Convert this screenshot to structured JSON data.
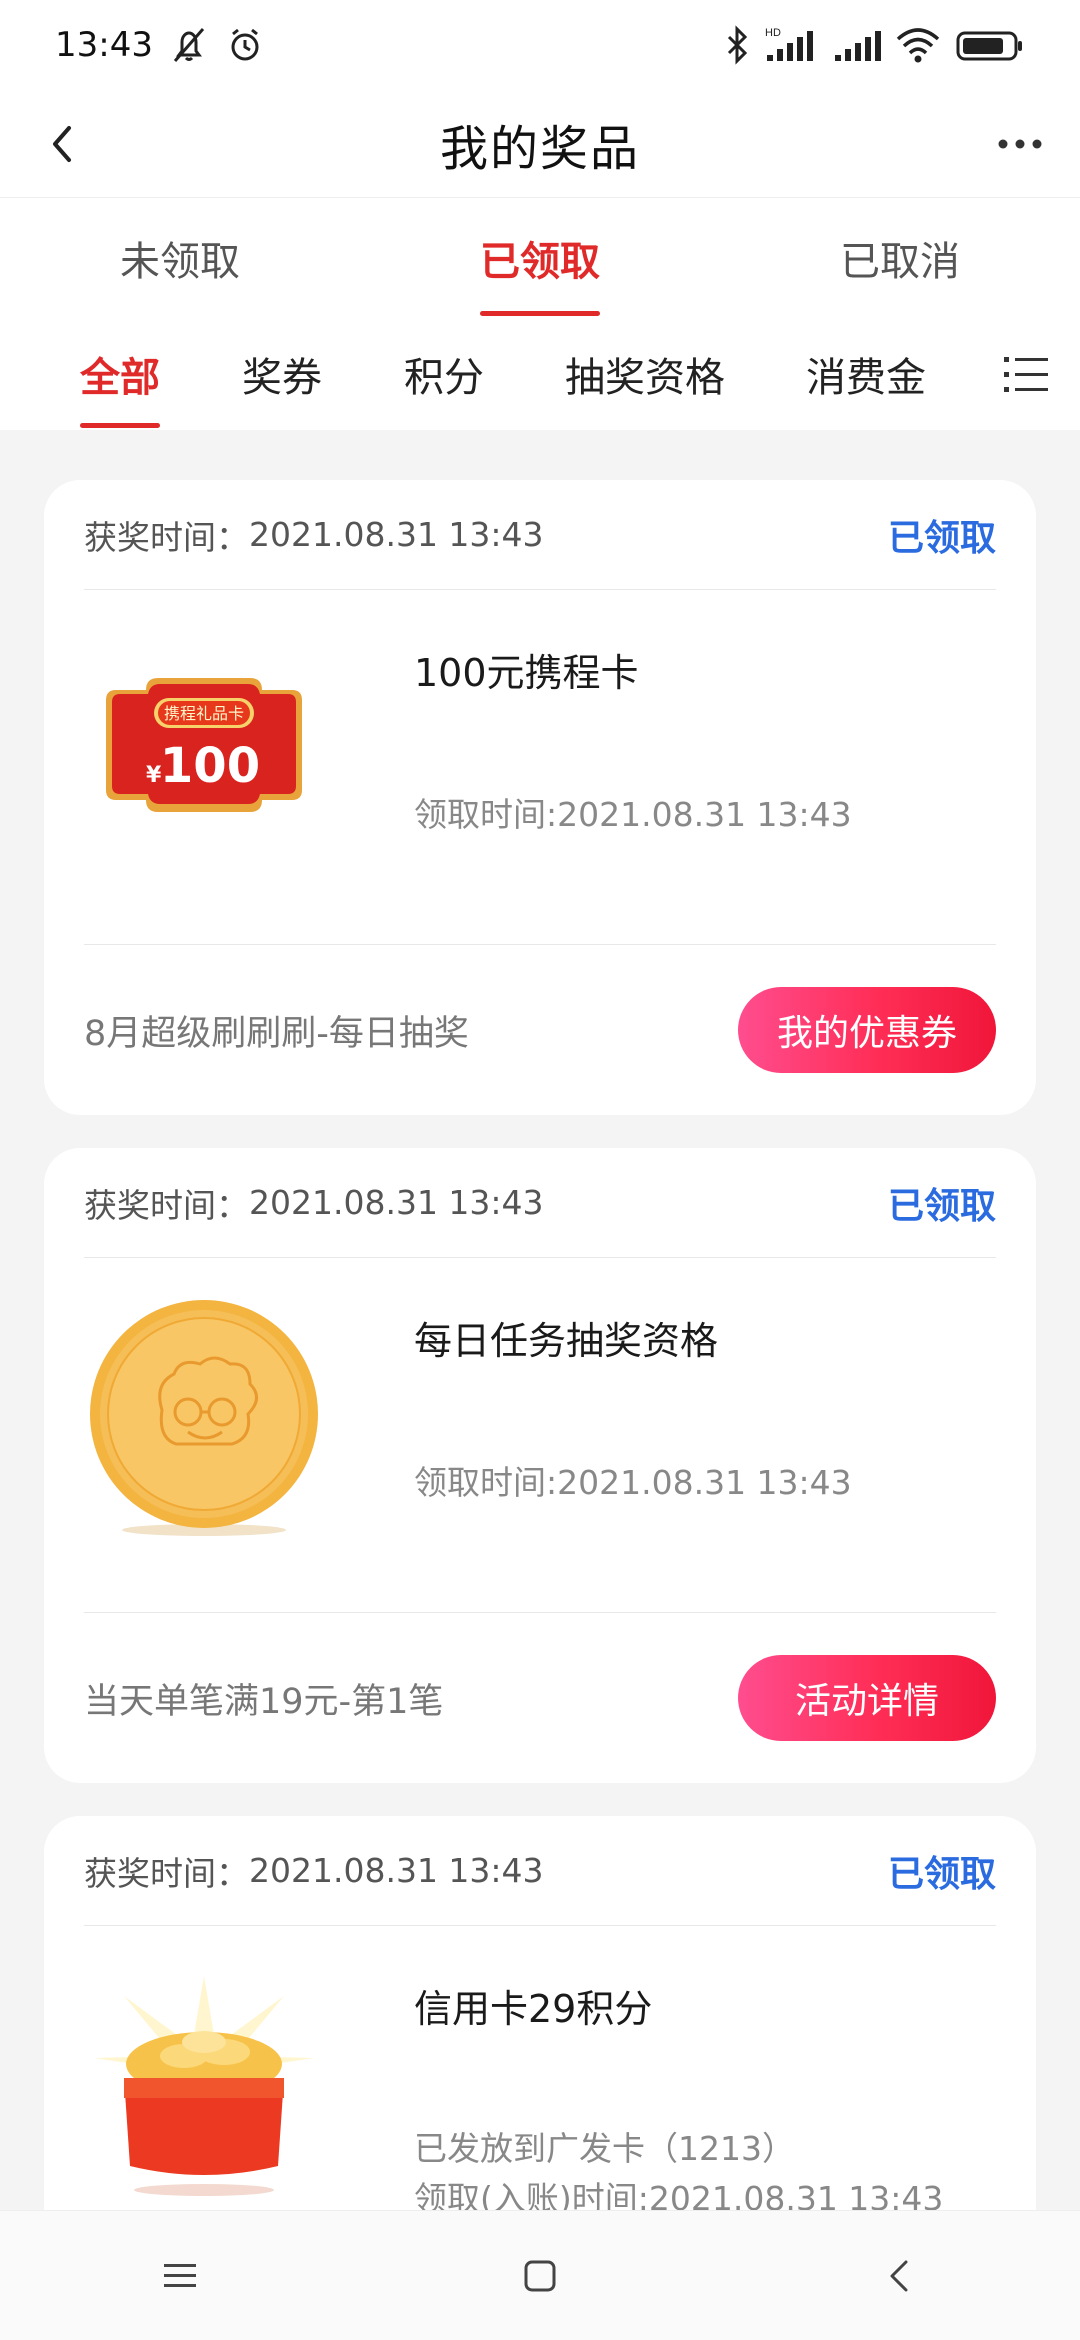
{
  "status_bar": {
    "time": "13:43",
    "hd_label": "HD"
  },
  "header": {
    "title": "我的奖品"
  },
  "status_tabs": [
    {
      "label": "未领取",
      "active": false
    },
    {
      "label": "已领取",
      "active": true
    },
    {
      "label": "已取消",
      "active": false
    }
  ],
  "category_tabs": [
    {
      "label": "全部",
      "active": true
    },
    {
      "label": "奖券",
      "active": false
    },
    {
      "label": "积分",
      "active": false
    },
    {
      "label": "抽奖资格",
      "active": false
    },
    {
      "label": "消费金",
      "active": false
    }
  ],
  "prizes": [
    {
      "win_label": "获奖时间：",
      "win_time": "2021.08.31 13:43",
      "state": "已领取",
      "name": "100元携程卡",
      "sub_lines": [
        "领取时间:2021.08.31 13:43"
      ],
      "card_badge": "携程礼品卡",
      "card_amount": "100",
      "card_currency": "¥",
      "source": "8月超级刷刷刷-每日抽奖",
      "action": "我的优惠券",
      "icon": "gift-card-icon"
    },
    {
      "win_label": "获奖时间：",
      "win_time": "2021.08.31 13:43",
      "state": "已领取",
      "name": "每日任务抽奖资格",
      "sub_lines": [
        "领取时间:2021.08.31 13:43"
      ],
      "source": "当天单笔满19元-第1笔",
      "action": "活动详情",
      "icon": "gold-coin-icon"
    },
    {
      "win_label": "获奖时间：",
      "win_time": "2021.08.31 13:43",
      "state": "已领取",
      "name": "信用卡29积分",
      "sub_lines": [
        "已发放到广发卡（1213）",
        "领取(入账)时间:2021.08.31 13:43"
      ],
      "icon": "treasure-box-icon"
    }
  ],
  "colors": {
    "accent_red": "#e02a2a",
    "state_blue": "#2b6be0",
    "button_pink": "#ff2d55"
  }
}
